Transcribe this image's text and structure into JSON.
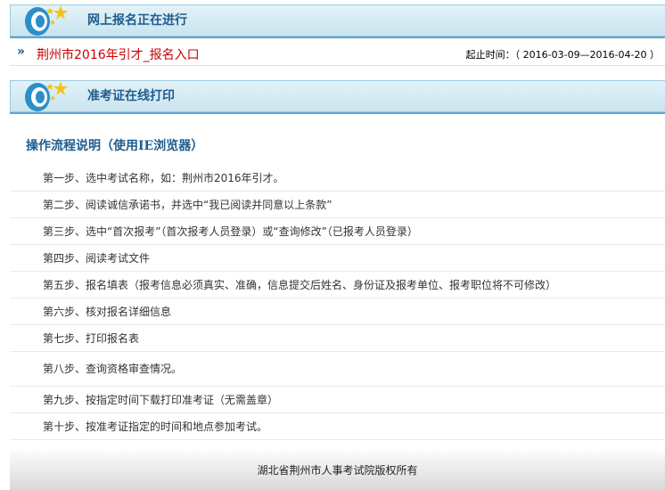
{
  "enroll": {
    "header_title": "网上报名正在进行",
    "item_link": "荆州市2016年引才_报名入口",
    "period_label": "起止时间：",
    "period_value": "（ 2016-03-09—2016-04-20 ）"
  },
  "admission": {
    "header_title": "准考证在线打印"
  },
  "procedure": {
    "title": "操作流程说明（使用IE浏览器）",
    "steps": [
      "第一步、选中考试名称，如：荆州市2016年引才。",
      "第二步、阅读诚信承诺书，并选中“我已阅读并同意以上条款”",
      "第三步、选中“首次报考”（首次报考人员登录）或“查询修改”（已报考人员登录）",
      "第四步、阅读考试文件",
      "第五步、报名填表（报考信息必须真实、准确，信息提交后姓名、身份证及报考单位、报考职位将不可修改）",
      "第六步、核对报名详细信息",
      "第七步、打印报名表",
      "第八步、查询资格审查情况。",
      "第九步、按指定时间下载打印准考证（无需盖章）",
      "第十步、按准考证指定的时间和地点参加考试。"
    ]
  },
  "footer": {
    "copyright": "湖北省荆州市人事考试院版权所有"
  },
  "colors": {
    "header_text": "#1f5c8d",
    "link_red": "#cc0000",
    "header_bg": "#d4ebf4",
    "underline": "#5aa7cc"
  },
  "icons": [
    "speaker-star-logo",
    "double-chevron-right-icon"
  ]
}
